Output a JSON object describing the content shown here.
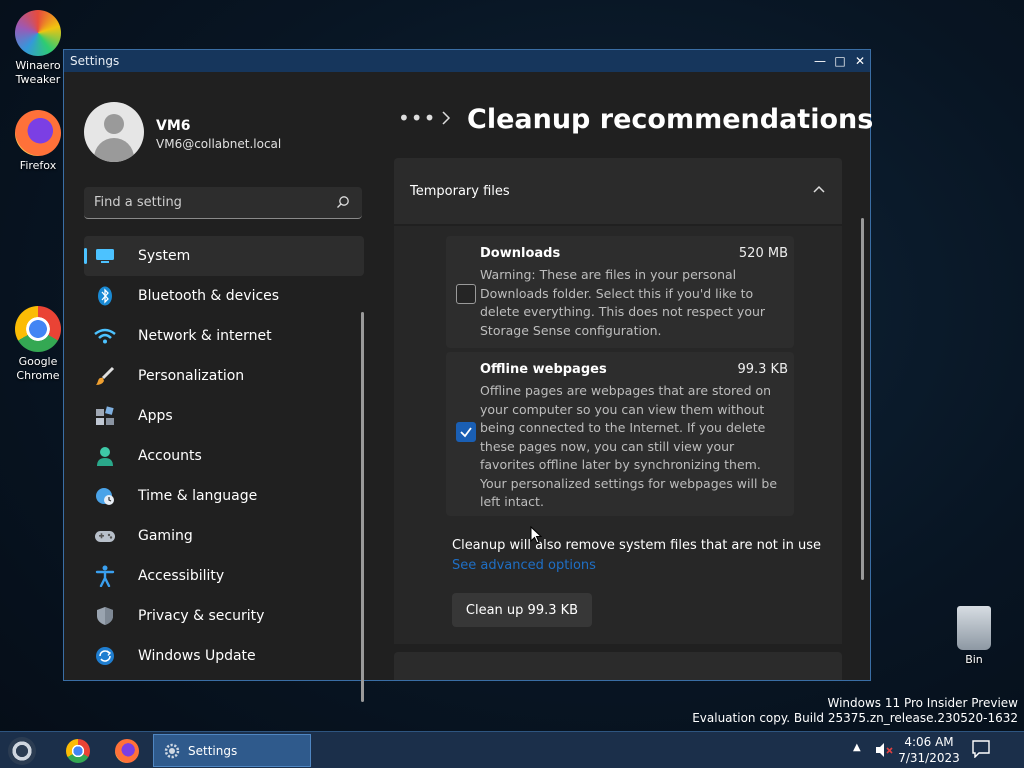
{
  "desktop": {
    "icons": [
      {
        "label": "Winaero Tweaker"
      },
      {
        "label": "Firefox"
      },
      {
        "label": "Google Chrome"
      },
      {
        "label": "Bin"
      }
    ]
  },
  "window": {
    "title": "Settings",
    "controls": {
      "minimize": "—",
      "maximize": "□",
      "close": "✕"
    }
  },
  "sidebar": {
    "user_name": "VM6",
    "user_email": "VM6@collabnet.local",
    "search_placeholder": "Find a setting",
    "items": [
      {
        "label": "System",
        "icon": "monitor-icon",
        "active": true
      },
      {
        "label": "Bluetooth & devices",
        "icon": "bluetooth-icon"
      },
      {
        "label": "Network & internet",
        "icon": "wifi-icon"
      },
      {
        "label": "Personalization",
        "icon": "brush-icon"
      },
      {
        "label": "Apps",
        "icon": "apps-icon"
      },
      {
        "label": "Accounts",
        "icon": "person-icon"
      },
      {
        "label": "Time & language",
        "icon": "globe-clock-icon"
      },
      {
        "label": "Gaming",
        "icon": "controller-icon"
      },
      {
        "label": "Accessibility",
        "icon": "accessibility-icon"
      },
      {
        "label": "Privacy & security",
        "icon": "shield-icon"
      },
      {
        "label": "Windows Update",
        "icon": "update-icon"
      }
    ]
  },
  "main": {
    "breadcrumb_dots": "•••",
    "title": "Cleanup recommendations",
    "section": {
      "label": "Temporary files",
      "expanded": true
    },
    "files": [
      {
        "name": "Downloads",
        "size": "520 MB",
        "checked": false,
        "description": "Warning: These are files in your personal Downloads folder. Select this if you'd like to delete everything. This does not respect your Storage Sense configuration."
      },
      {
        "name": "Offline webpages",
        "size": "99.3 KB",
        "checked": true,
        "description": "Offline pages are webpages that are stored on your computer so you can view them without being connected to the Internet.  If you delete these pages now, you can still view your favorites offline later by synchronizing them.  Your personalized settings for webpages will be left intact."
      }
    ],
    "system_note": "Cleanup will also remove system files that are not in use",
    "advanced_link": "See advanced options",
    "cleanup_button": "Clean up 99.3 KB"
  },
  "watermark": {
    "line1": "Windows 11 Pro Insider Preview",
    "line2": "Evaluation copy. Build 25375.zn_release.230520-1632"
  },
  "taskbar": {
    "active_app": "Settings",
    "time": "4:06 AM",
    "date": "7/31/2023"
  },
  "colors": {
    "accent": "#4cc2ff",
    "link": "#1f6fc5",
    "checkbox_checked": "#1a5fb4",
    "window_bg": "#202020"
  }
}
